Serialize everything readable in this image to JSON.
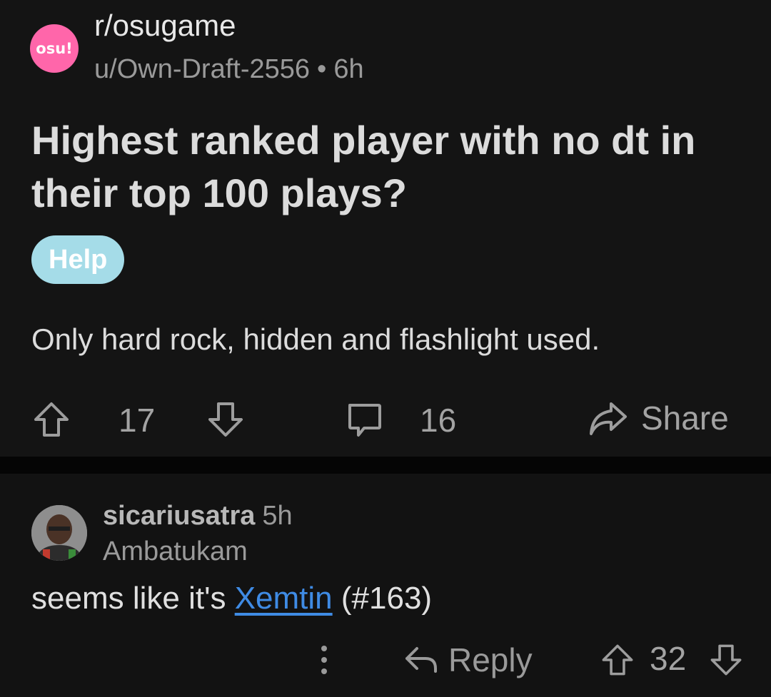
{
  "post": {
    "subreddit": "r/osugame",
    "subreddit_icon_text": "osu!",
    "subreddit_icon_color": "#ff66aa",
    "author": "u/Own-Draft-2556",
    "separator": "•",
    "age": "6h",
    "title": "Highest ranked player with no dt in their top 100 plays?",
    "flair": "Help",
    "flair_color": "#a5dce8",
    "body": "Only hard rock, hidden and flashlight used.",
    "score": "17",
    "comment_count": "16",
    "share_label": "Share"
  },
  "comment": {
    "author": "sicariusatra",
    "age": "5h",
    "user_flair": "Ambatukam",
    "body_prefix": "seems like it's ",
    "link_text": "Xemtin",
    "body_suffix": " (#163)",
    "link_color": "#3f8be4",
    "reply_label": "Reply",
    "score": "32"
  },
  "icons": {
    "upvote": "upvote-arrow-icon",
    "downvote": "downvote-arrow-icon",
    "comments": "speech-bubble-icon",
    "share": "share-arrow-icon",
    "reply": "reply-arrow-icon",
    "more": "vertical-dots-icon"
  }
}
